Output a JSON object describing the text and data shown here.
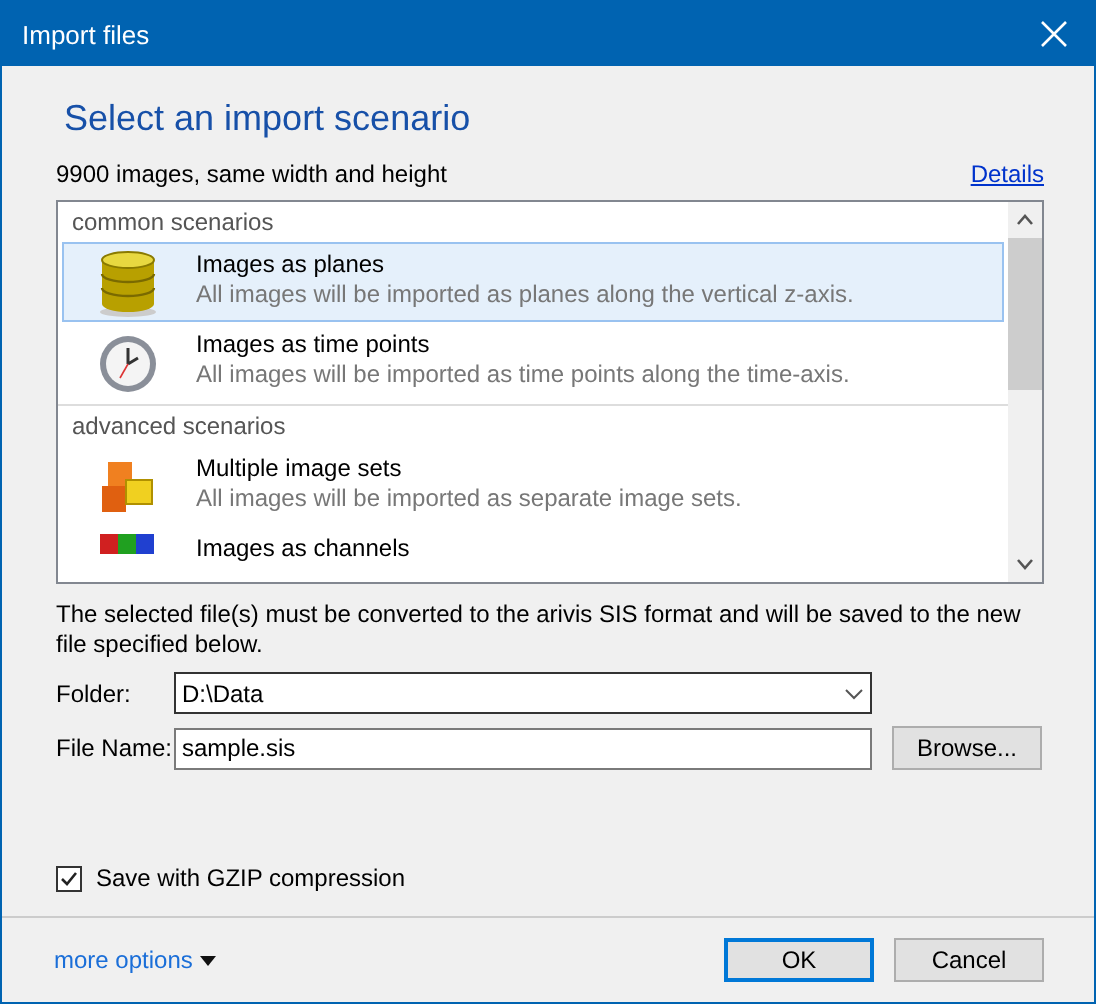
{
  "window": {
    "title": "Import files"
  },
  "heading": "Select an import scenario",
  "summary": "9900 images, same width and height",
  "details_link": "Details",
  "groups": [
    {
      "label": "common scenarios",
      "items": [
        {
          "title": "Images as planes",
          "description": "All images will be imported as planes along the vertical z-axis.",
          "selected": true
        },
        {
          "title": "Images as time points",
          "description": "All images will be imported as time points along the time-axis.",
          "selected": false
        }
      ]
    },
    {
      "label": "advanced scenarios",
      "items": [
        {
          "title": "Multiple image sets",
          "description": "All images will be imported as separate image sets.",
          "selected": false
        },
        {
          "title": "Images as channels",
          "selected": false
        }
      ]
    }
  ],
  "message": "The selected file(s) must be converted to the arivis SIS format and will be saved to the new file specified below.",
  "folder": {
    "label": "Folder:",
    "value": "D:\\Data"
  },
  "file_name": {
    "label": "File Name:",
    "value": "sample.sis"
  },
  "browse_button": "Browse...",
  "gzip": {
    "label": "Save with GZIP compression",
    "checked": true
  },
  "more_options": "more options",
  "buttons": [
    {
      "label": "OK",
      "default": true
    },
    {
      "label": "Cancel",
      "default": false
    }
  ]
}
